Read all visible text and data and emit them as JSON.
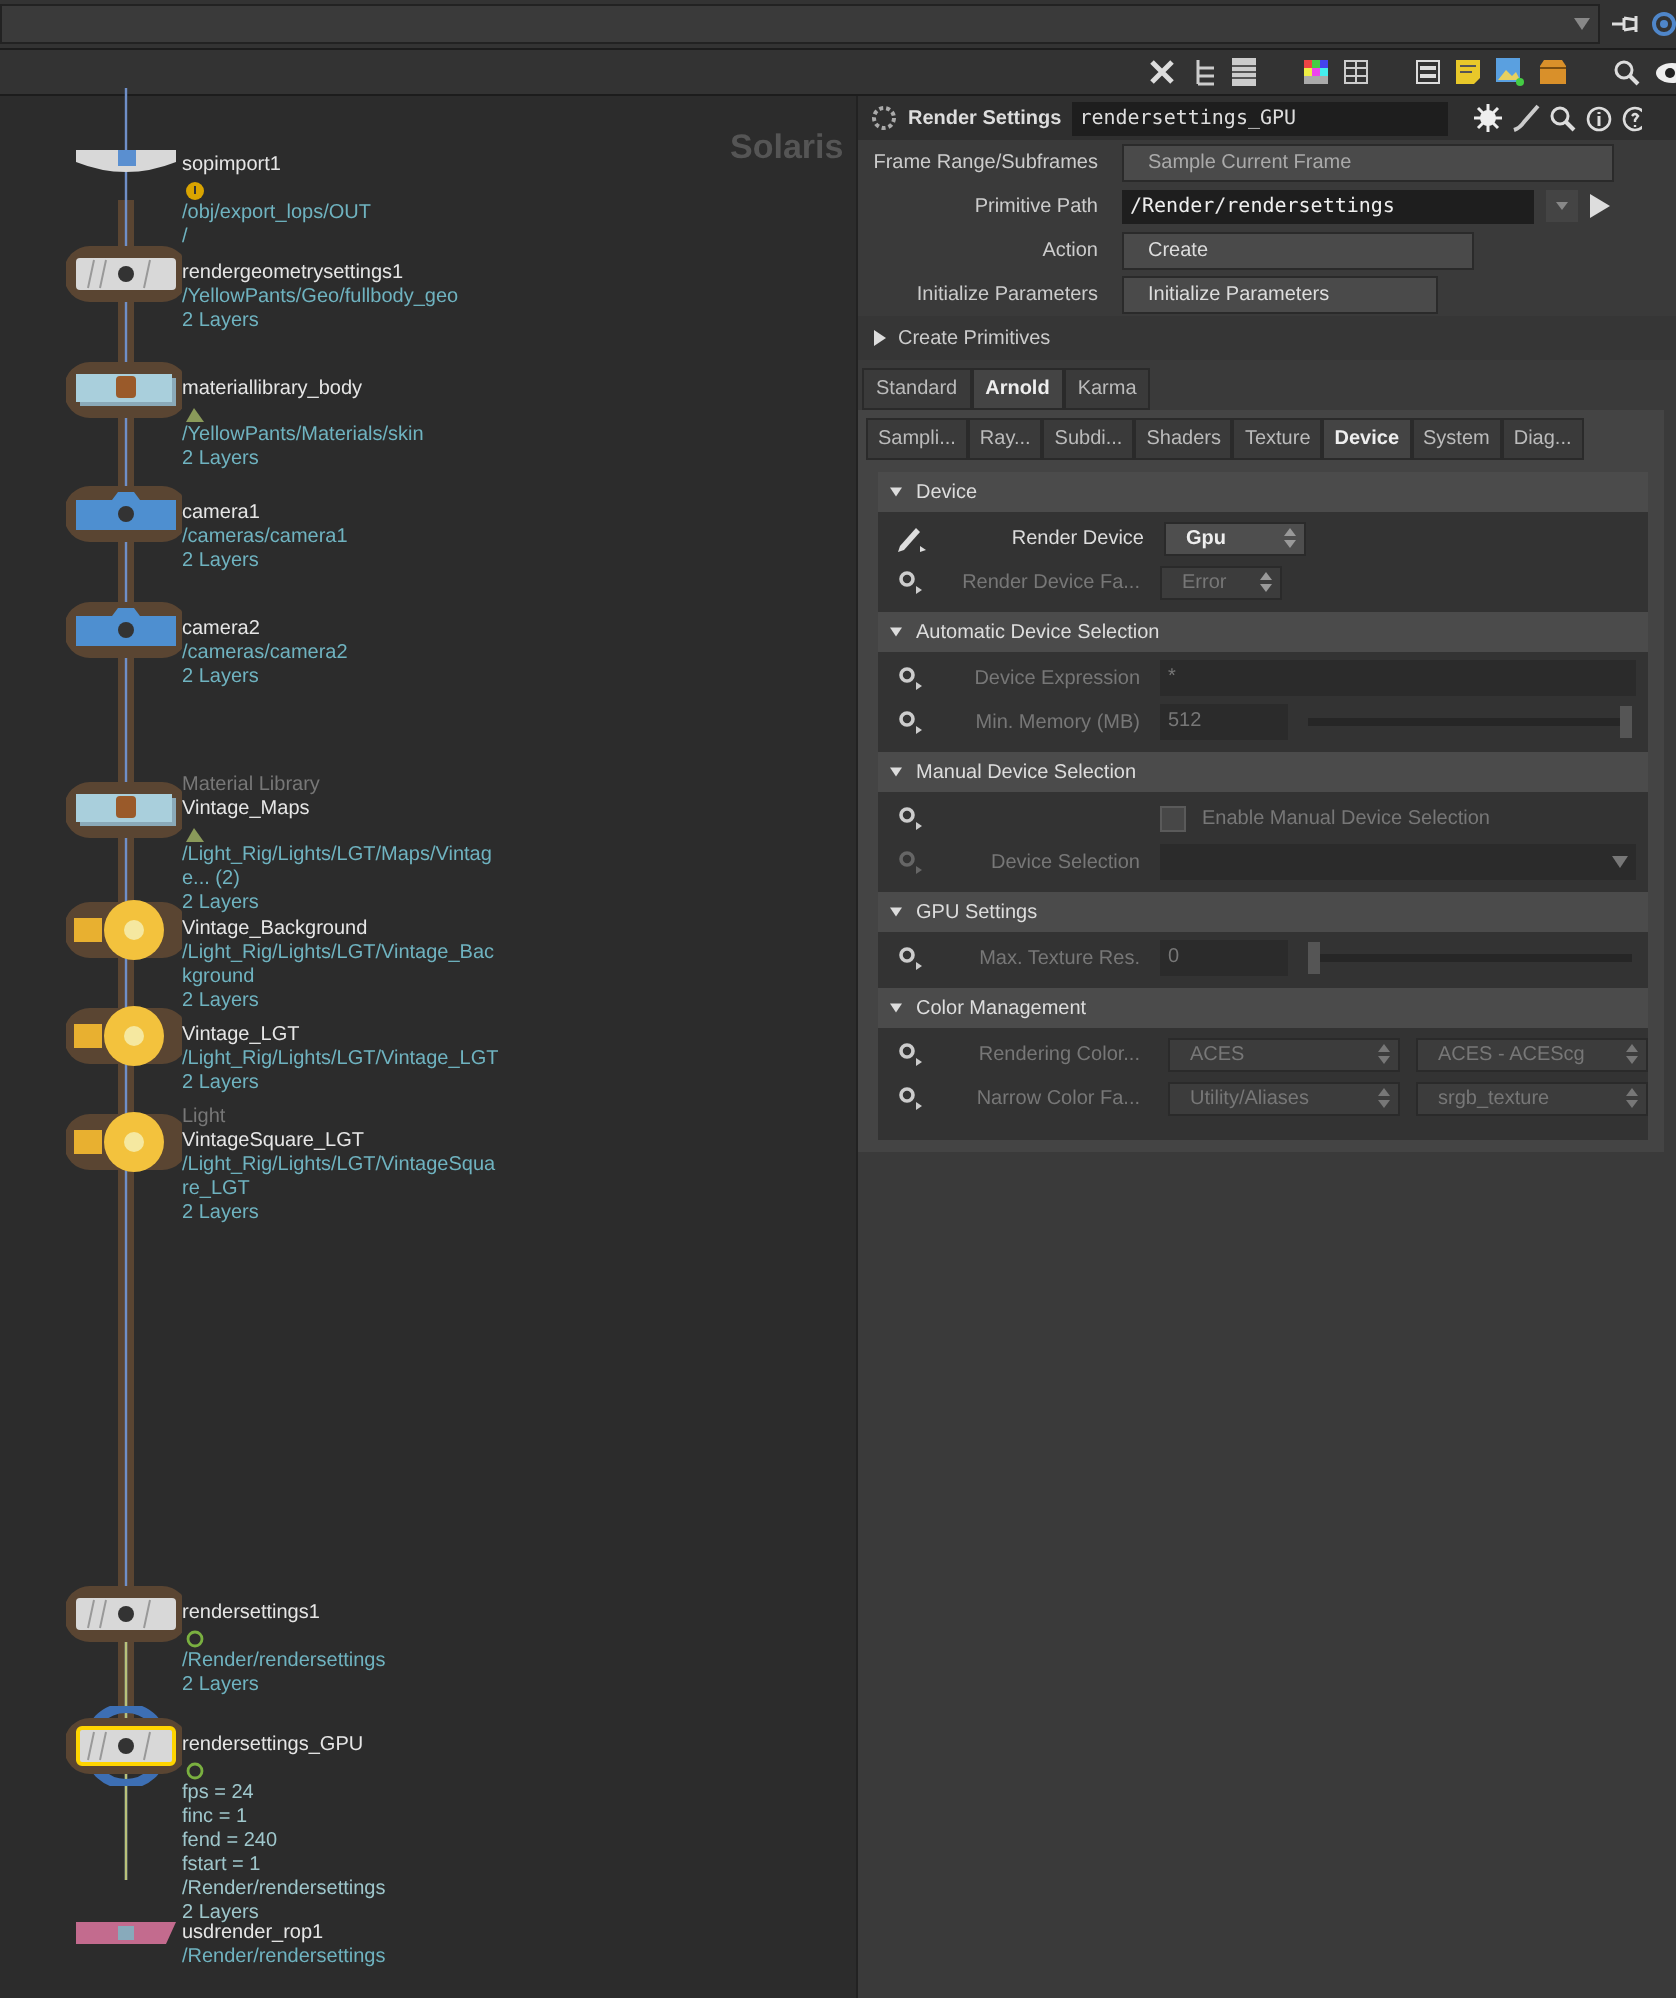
{
  "network": {
    "context_label": "Solaris",
    "nodes": [
      {
        "kind": "sop",
        "name": "sopimport1",
        "selected": false,
        "info": [
          "/obj/export_lops/OUT",
          "/"
        ]
      },
      {
        "kind": "geo",
        "name": "rendergeometrysettings1",
        "selected": false,
        "info": [
          "/YellowPants/Geo/fullbody_geo",
          "2 Layers"
        ]
      },
      {
        "kind": "matlib",
        "name": "materiallibrary_body",
        "selected": false,
        "info": [
          "/YellowPants/Materials/skin",
          "2 Layers"
        ]
      },
      {
        "kind": "camera",
        "name": "camera1",
        "selected": false,
        "info": [
          "/cameras/camera1",
          "2 Layers"
        ]
      },
      {
        "kind": "camera",
        "name": "camera2",
        "selected": false,
        "info": [
          "/cameras/camera2",
          "2 Layers"
        ]
      },
      {
        "kind": "matlib",
        "type_label": "Material Library",
        "name": "Vintage_Maps",
        "selected": false,
        "info": [
          "/Light_Rig/Lights/LGT/Maps/Vintag",
          "e... (2)",
          "2 Layers"
        ]
      },
      {
        "kind": "light",
        "name": "Vintage_Background",
        "selected": false,
        "info": [
          "/Light_Rig/Lights/LGT/Vintage_Bac",
          "kground",
          "2 Layers"
        ]
      },
      {
        "kind": "light",
        "name": "Vintage_LGT",
        "selected": false,
        "info": [
          "/Light_Rig/Lights/LGT/Vintage_LGT",
          "2 Layers"
        ]
      },
      {
        "kind": "light",
        "type_label": "Light",
        "name": "VintageSquare_LGT",
        "selected": false,
        "info": [
          "/Light_Rig/Lights/LGT/VintageSqua",
          "re_LGT",
          "2 Layers"
        ]
      },
      {
        "kind": "render",
        "name": "rendersettings1",
        "selected": false,
        "info": [
          "/Render/rendersettings",
          "2 Layers"
        ]
      },
      {
        "kind": "render",
        "name": "rendersettings_GPU",
        "selected": true,
        "info": [
          "fps = 24",
          "finc = 1",
          "fend = 240",
          "fstart = 1",
          "/Render/rendersettings",
          "2 Layers"
        ]
      },
      {
        "kind": "rop",
        "name": "usdrender_rop1",
        "selected": false,
        "info": [
          "/Render/rendersettings"
        ]
      }
    ]
  },
  "parameters": {
    "title": "Render Settings",
    "node_name": "rendersettings_GPU",
    "top_rows": [
      {
        "kind": "menu",
        "label": "Frame Range/Subframes",
        "value": "Sample Current Frame"
      },
      {
        "kind": "string",
        "label": "Primitive Path",
        "value": "/Render/rendersettings"
      },
      {
        "kind": "menu",
        "label": "Action",
        "value": "Create"
      },
      {
        "kind": "button_menu",
        "label": "Initialize Parameters",
        "value": "Initialize Parameters"
      }
    ],
    "folder": {
      "label": "Create Primitives",
      "expanded": false
    },
    "tabs": [
      {
        "label": "Standard",
        "selected": false
      },
      {
        "label": "Arnold",
        "selected": true
      },
      {
        "label": "Karma",
        "selected": false
      }
    ],
    "subtabs": [
      {
        "label": "Sampli...",
        "selected": false
      },
      {
        "label": "Ray...",
        "selected": false
      },
      {
        "label": "Subdi...",
        "selected": false
      },
      {
        "label": "Shaders",
        "selected": false
      },
      {
        "label": "Texture",
        "selected": false
      },
      {
        "label": "Device",
        "selected": true
      },
      {
        "label": "System",
        "selected": false
      },
      {
        "label": "Diag...",
        "selected": false
      }
    ],
    "sections": [
      {
        "title": "Device",
        "expanded": true,
        "rows": [
          {
            "kind": "menu",
            "label": "Render Device",
            "value": "Gpu",
            "disabled": false
          },
          {
            "kind": "menu",
            "label": "Render Device Fa...",
            "value": "Error",
            "disabled": true
          }
        ]
      },
      {
        "title": "Automatic Device Selection",
        "expanded": true,
        "rows": [
          {
            "kind": "string",
            "label": "Device Expression",
            "value": "*",
            "disabled": true
          },
          {
            "kind": "slider",
            "label": "Min. Memory (MB)",
            "value": "512",
            "level": 1,
            "disabled": true
          }
        ]
      },
      {
        "title": "Manual Device Selection",
        "expanded": true,
        "rows": [
          {
            "kind": "toggle",
            "label": "Enable Manual Device Selection",
            "checked": false,
            "disabled": true
          },
          {
            "kind": "dropdown",
            "label": "Device Selection",
            "disabled": true
          }
        ]
      },
      {
        "title": "GPU Settings",
        "expanded": true,
        "rows": [
          {
            "kind": "slider",
            "label": "Max. Texture Res.",
            "value": "0",
            "level": 0,
            "disabled": true
          }
        ]
      },
      {
        "title": "Color Management",
        "expanded": true,
        "rows": [
          {
            "kind": "menu_pair",
            "label": "Rendering Color...",
            "values": [
              "ACES",
              "ACES - ACEScg"
            ],
            "disabled": true
          },
          {
            "kind": "menu_pair",
            "label": "Narrow Color Fa...",
            "values": [
              "Utility/Aliases",
              "srgb_texture"
            ],
            "disabled": true
          }
        ]
      }
    ]
  }
}
